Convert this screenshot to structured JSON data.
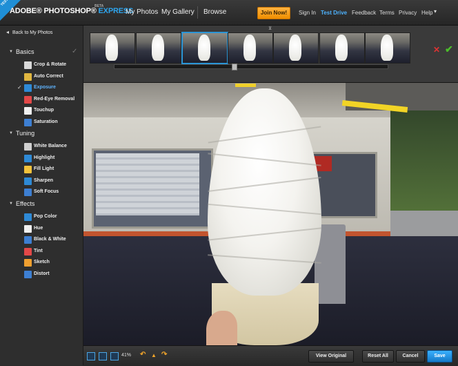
{
  "header": {
    "ribbon": "TEST DRIVE",
    "logo_main": "ADOBE® PHOTOSHOP®",
    "logo_express": "EXPRESS",
    "beta": "BETA",
    "nav": [
      "My Photos",
      "My Gallery",
      "Browse"
    ],
    "join_button": "Join Now!",
    "links": [
      "Sign In",
      "Test Drive",
      "Feedback",
      "Terms",
      "Privacy",
      "Help"
    ],
    "active_link": "Test Drive",
    "accent": "#2ea4ec"
  },
  "sidebar": {
    "back": "Back to My Photos",
    "sections": [
      {
        "label": "Basics",
        "tools": [
          {
            "label": "Crop & Rotate",
            "icon": "crop-icon",
            "color": "#d9d9d9"
          },
          {
            "label": "Auto Correct",
            "icon": "wand-icon",
            "color": "#e0b640"
          },
          {
            "label": "Exposure",
            "icon": "exposure-icon",
            "color": "#2e8ad6",
            "active": true
          },
          {
            "label": "Red-Eye Removal",
            "icon": "eye-icon",
            "color": "#e34848"
          },
          {
            "label": "Touchup",
            "icon": "hand-icon",
            "color": "#f0f0f0"
          },
          {
            "label": "Saturation",
            "icon": "saturation-icon",
            "color": "#3d7fd2"
          }
        ]
      },
      {
        "label": "Tuning",
        "tools": [
          {
            "label": "White Balance",
            "icon": "white-balance-icon",
            "color": "#cfcfcf"
          },
          {
            "label": "Highlight",
            "icon": "highlight-icon",
            "color": "#2e8ad6"
          },
          {
            "label": "Fill Light",
            "icon": "bulb-icon",
            "color": "#f2c23b"
          },
          {
            "label": "Sharpen",
            "icon": "sharpen-icon",
            "color": "#2e8ad6"
          },
          {
            "label": "Soft Focus",
            "icon": "soft-focus-icon",
            "color": "#3d7fd2"
          }
        ]
      },
      {
        "label": "Effects",
        "tools": [
          {
            "label": "Pop Color",
            "icon": "pop-color-icon",
            "color": "#2e8ad6"
          },
          {
            "label": "Hue",
            "icon": "hue-icon",
            "color": "#f0f0f0"
          },
          {
            "label": "Black & White",
            "icon": "bw-icon",
            "color": "#3d7fd2"
          },
          {
            "label": "Tint",
            "icon": "tint-icon",
            "color": "#e34848"
          },
          {
            "label": "Sketch",
            "icon": "sketch-icon",
            "color": "#f0a030"
          },
          {
            "label": "Distort",
            "icon": "distort-icon",
            "color": "#3d7fd2"
          }
        ]
      }
    ]
  },
  "filmstrip": {
    "thumbnail_count": 7,
    "selected_index": 2
  },
  "bottom": {
    "zoom": "41%",
    "view_original": "View Original",
    "reset_all": "Reset All",
    "cancel": "Cancel",
    "save": "Save"
  }
}
